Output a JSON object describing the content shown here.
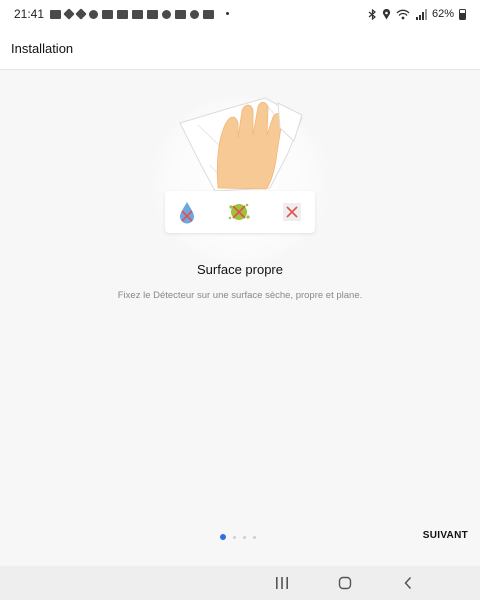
{
  "status_bar": {
    "time": "21:41",
    "battery": "62%",
    "icons": [
      "notification-icon",
      "diamond-icon",
      "diamond-icon",
      "notification-icon",
      "notification-icon",
      "notification-icon",
      "notification-icon",
      "notification-icon",
      "notification-icon",
      "notification-icon",
      "notification-icon",
      "notification-icon"
    ],
    "right_icons": [
      "bluetooth-icon",
      "location-icon",
      "wifi-icon",
      "signal-icon"
    ]
  },
  "app_bar": {
    "title": "Installation"
  },
  "hero": {
    "icons": [
      "water-drop-crossed-icon",
      "dirt-crossed-icon",
      "crossed-square-icon"
    ]
  },
  "content": {
    "heading": "Surface propre",
    "description": "Fixez le Détecteur sur une surface sèche, propre et plane."
  },
  "pager": {
    "total": 4,
    "active_index": 0
  },
  "footer": {
    "next_label": "SUIVANT"
  },
  "nav_bar": {
    "buttons": [
      "recents-icon",
      "home-icon",
      "back-icon"
    ]
  },
  "colors": {
    "accent": "#2f6fe0",
    "cross": "#e05252",
    "skin": "#f6c995"
  }
}
